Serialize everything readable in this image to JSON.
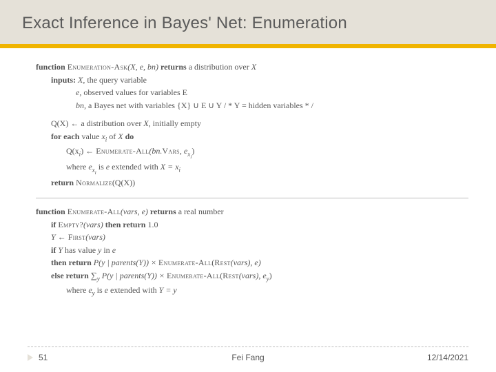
{
  "title": "Exact Inference in Bayes' Net: Enumeration",
  "algo1": {
    "fn_kw": "function",
    "fn_name": "Enumeration-Ask",
    "fn_args": "(X, e, bn)",
    "returns_kw": "returns",
    "returns_txt": " a distribution over ",
    "returnsVar": "X",
    "inputs_kw": "inputs:",
    "in1a": " X, ",
    "in1b": "the query variable",
    "in2a": "e, ",
    "in2b": "observed values for variables ",
    "in2c": "E",
    "in3a": "bn, ",
    "in3b": "a Bayes net with variables ",
    "in3c": "{X} ∪ E ∪ Y",
    "in3d": "   / * Y = hidden variables * /",
    "l1a": "Q(X) ← ",
    "l1b": "a distribution over ",
    "l1c": "X",
    "l1d": ", initially empty",
    "l2a": "for each ",
    "l2b": "value ",
    "l2c": "x",
    "l2ci": "i",
    "l2d": " of ",
    "l2e": "X ",
    "l2f": "do",
    "l3a": "Q(x",
    "l3ai": "i",
    "l3b": ") ← ",
    "l3c": "Enumerate-All",
    "l3d": "(bn.",
    "l3e": "Vars",
    "l3f": ", e",
    "l3fi": "x",
    "l3fii": "i",
    "l3g": ")",
    "l4a": "where ",
    "l4b": "e",
    "l4bi": "x",
    "l4bii": "i",
    "l4c": " is ",
    "l4d": "e ",
    "l4e": "extended with ",
    "l4f": "X = x",
    "l4fi": "i",
    "l5a": "return ",
    "l5b": "Normalize",
    "l5c": "(Q(X))"
  },
  "algo2": {
    "fn_kw": "function",
    "fn_name": "Enumerate-All",
    "fn_args": "(vars, e)",
    "returns_kw": "returns",
    "returns_txt": " a real number",
    "l1a": "if ",
    "l1b": "Empty?",
    "l1c": "(vars) ",
    "l1d": "then return ",
    "l1e": "1.0",
    "l2a": "Y ← ",
    "l2b": "First",
    "l2c": "(vars)",
    "l3a": "if ",
    "l3b": "Y ",
    "l3c": "has value ",
    "l3d": "y ",
    "l3e": "in ",
    "l3f": "e",
    "l4a": "then return ",
    "l4b": "P(y | parents(Y))  ×  ",
    "l4c": "Enumerate-All",
    "l4d": "(",
    "l4e": "Rest",
    "l4f": "(vars), e)",
    "l5a": "else return ",
    "l5b": "∑",
    "l5bi": "y",
    "l5c": "  P(y | parents(Y))  ×  ",
    "l5d": "Enumerate-All",
    "l5e": "(",
    "l5f": "Rest",
    "l5g": "(vars), e",
    "l5gi": "y",
    "l5h": ")",
    "l6a": "where ",
    "l6b": "e",
    "l6bi": "y",
    "l6c": " is ",
    "l6d": "e ",
    "l6e": "extended with ",
    "l6f": "Y = y"
  },
  "footer": {
    "page": "51",
    "author": "Fei Fang",
    "date": "12/14/2021"
  }
}
